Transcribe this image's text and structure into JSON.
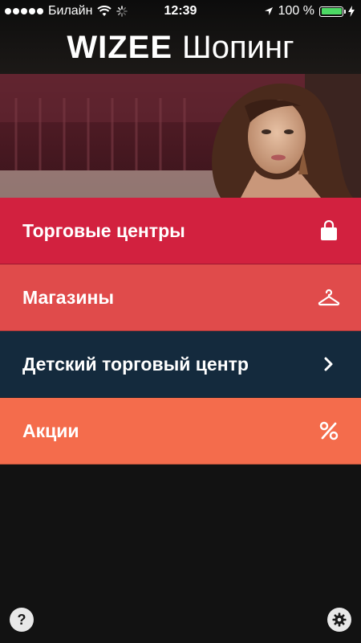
{
  "status_bar": {
    "carrier": "Билайн",
    "time": "12:39",
    "battery_percent": "100 %",
    "battery_level": 1.0
  },
  "header": {
    "brand_strong": "WIZEE",
    "brand_light": "Шопинг"
  },
  "menu": {
    "items": [
      {
        "label": "Торговые центры",
        "icon": "shopping-bag-icon",
        "color": "#d2213f"
      },
      {
        "label": "Магазины",
        "icon": "hanger-icon",
        "color": "#e04b4b"
      },
      {
        "label": "Детский торговый центр",
        "icon": "chevron-right-icon",
        "color": "#142a3d"
      },
      {
        "label": "Акции",
        "icon": "percent-icon",
        "color": "#f46c4c"
      }
    ]
  },
  "colors": {
    "background": "#121212",
    "battery_fill": "#4cd964"
  },
  "bottom": {
    "help_icon": "question-icon",
    "settings_icon": "gear-icon"
  }
}
